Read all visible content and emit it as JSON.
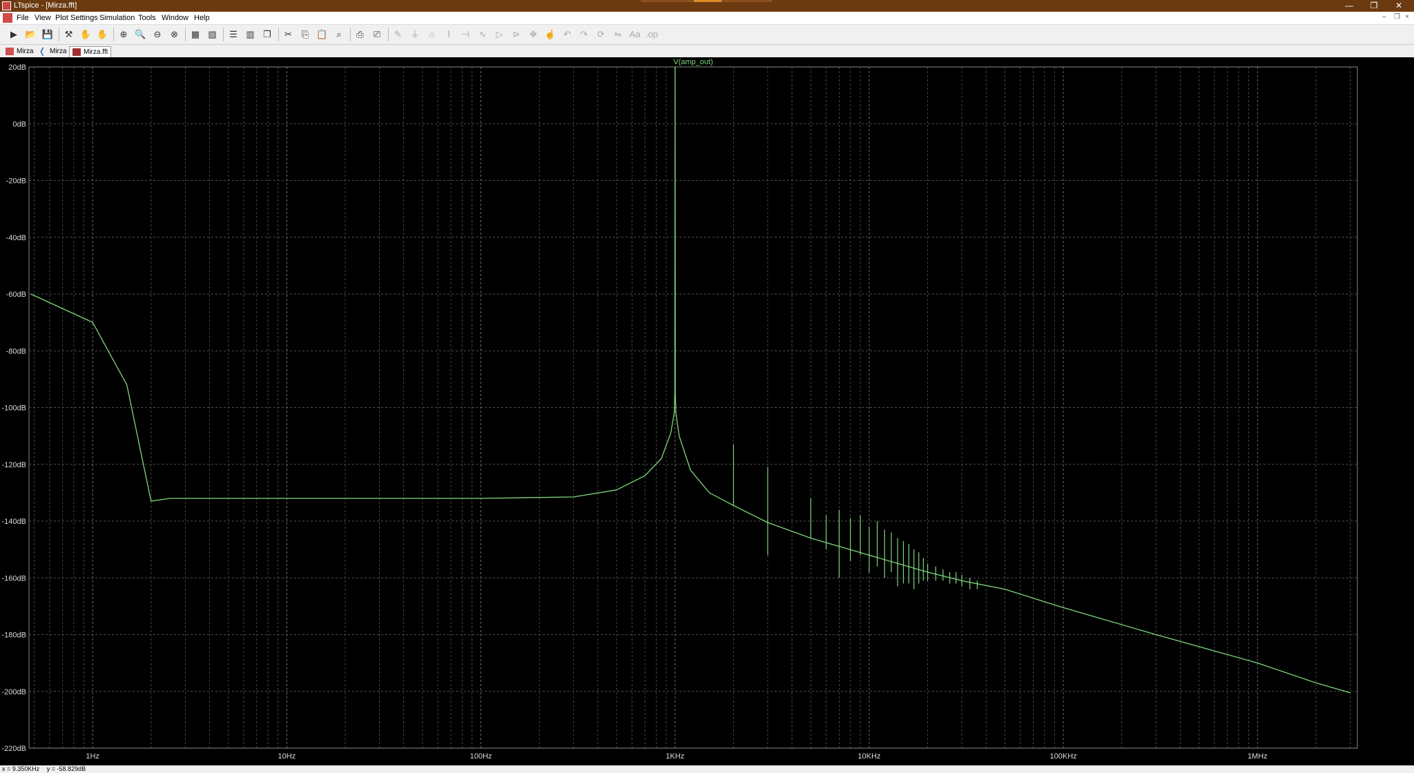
{
  "window": {
    "title": "LTspice - [Mirza.fft]",
    "minimize": "—",
    "restore": "❐",
    "close": "✕"
  },
  "menubar": {
    "items": [
      "File",
      "View",
      "Plot Settings",
      "Simulation",
      "Tools",
      "Window",
      "Help"
    ]
  },
  "toolbar": {
    "icons": [
      "run-icon",
      "open-icon",
      "save-icon",
      "control-panel-icon",
      "halt-icon",
      "pan-icon",
      "zoom-in-icon",
      "zoom-area-icon",
      "zoom-out-icon",
      "zoom-cancel-icon",
      "autorange-icon",
      "mark-icon",
      "tile-horizontal-icon",
      "tile-vertical-icon",
      "cascade-icon",
      "cut-icon",
      "copy-icon",
      "paste-icon",
      "find-icon",
      "print-icon",
      "print-preview-icon",
      "wire-icon",
      "ground-icon",
      "label-net-icon",
      "resistor-icon",
      "capacitor-icon",
      "inductor-icon",
      "diode-icon",
      "component-icon",
      "move-icon",
      "drag-icon",
      "undo-icon",
      "redo-icon",
      "rotate-icon",
      "mirror-icon",
      "text-icon",
      "spice-directive-icon"
    ]
  },
  "tabs": [
    {
      "label": "Mirza",
      "icon": "schematic-icon"
    },
    {
      "label": "Mirza",
      "icon": "waveform-icon"
    },
    {
      "label": "Mirza.fft",
      "icon": "fft-icon"
    }
  ],
  "status": {
    "x": "x = 9.350KHz",
    "y": "y = -58.829dB"
  },
  "colors": {
    "trace": "#7ed97e",
    "grid": "#7a7a7a",
    "background": "#000000",
    "axis_text": "#dcdcdc"
  },
  "chart_data": {
    "type": "line",
    "title": "V(amp_out)",
    "xscale": "log",
    "xlim": [
      0.47,
      3270000
    ],
    "ylim": [
      -220,
      20
    ],
    "y_ticks": [
      "20dB",
      "0dB",
      "-20dB",
      "-40dB",
      "-60dB",
      "-80dB",
      "-100dB",
      "-120dB",
      "-140dB",
      "-160dB",
      "-180dB",
      "-200dB",
      "-220dB"
    ],
    "y_tick_values": [
      20,
      0,
      -20,
      -40,
      -60,
      -80,
      -100,
      -120,
      -140,
      -160,
      -180,
      -200,
      -220
    ],
    "x_ticks": [
      "1Hz",
      "10Hz",
      "100Hz",
      "1KHz",
      "10KHz",
      "100KHz",
      "1MHz"
    ],
    "x_tick_values": [
      1,
      10,
      100,
      1000,
      10000,
      100000,
      1000000
    ],
    "series": [
      {
        "points": [
          [
            0.48,
            -60
          ],
          [
            1,
            -70
          ],
          [
            1.5,
            -92
          ],
          [
            2,
            -133
          ],
          [
            2.5,
            -132
          ],
          [
            3,
            -132
          ],
          [
            10,
            -132
          ],
          [
            100,
            -132
          ],
          [
            300,
            -131.5
          ],
          [
            500,
            -129
          ],
          [
            700,
            -124
          ],
          [
            850,
            -118
          ],
          [
            950,
            -109
          ],
          [
            990,
            -102
          ],
          [
            997,
            -95
          ],
          [
            1000,
            20
          ],
          [
            1003,
            -95
          ],
          [
            1010,
            -102
          ],
          [
            1050,
            -110
          ],
          [
            1200,
            -122
          ],
          [
            1500,
            -130
          ],
          [
            2000,
            -134.5
          ],
          [
            3000,
            -140.5
          ],
          [
            5000,
            -146
          ],
          [
            10000,
            -152
          ],
          [
            20000,
            -158
          ],
          [
            30000,
            -161
          ],
          [
            50000,
            -164
          ],
          [
            100000,
            -170.5
          ],
          [
            300000,
            -180
          ],
          [
            1000000,
            -190
          ],
          [
            2000000,
            -197
          ],
          [
            3000000,
            -200.5
          ]
        ]
      }
    ],
    "spurs": [
      [
        2000,
        -113,
        -134.5
      ],
      [
        3000,
        -121,
        -152
      ],
      [
        5000,
        -132,
        -146
      ],
      [
        6000,
        -138,
        -150
      ],
      [
        7000,
        -136,
        -160
      ],
      [
        8000,
        -139,
        -154
      ],
      [
        9000,
        -138,
        -152
      ],
      [
        10000,
        -142,
        -158
      ],
      [
        11000,
        -140,
        -156
      ],
      [
        12000,
        -143,
        -160
      ],
      [
        13000,
        -144,
        -158
      ],
      [
        14000,
        -146,
        -163
      ],
      [
        15000,
        -147,
        -162
      ],
      [
        16000,
        -148,
        -162
      ],
      [
        17000,
        -150,
        -164
      ],
      [
        18000,
        -151,
        -162
      ],
      [
        19000,
        -153,
        -161
      ],
      [
        20000,
        -155,
        -161
      ],
      [
        22000,
        -156,
        -161
      ],
      [
        24000,
        -157,
        -161
      ],
      [
        26000,
        -158,
        -162
      ],
      [
        28000,
        -158,
        -162
      ],
      [
        30000,
        -159,
        -163
      ],
      [
        33000,
        -160,
        -164
      ],
      [
        36000,
        -161,
        -164
      ]
    ]
  }
}
